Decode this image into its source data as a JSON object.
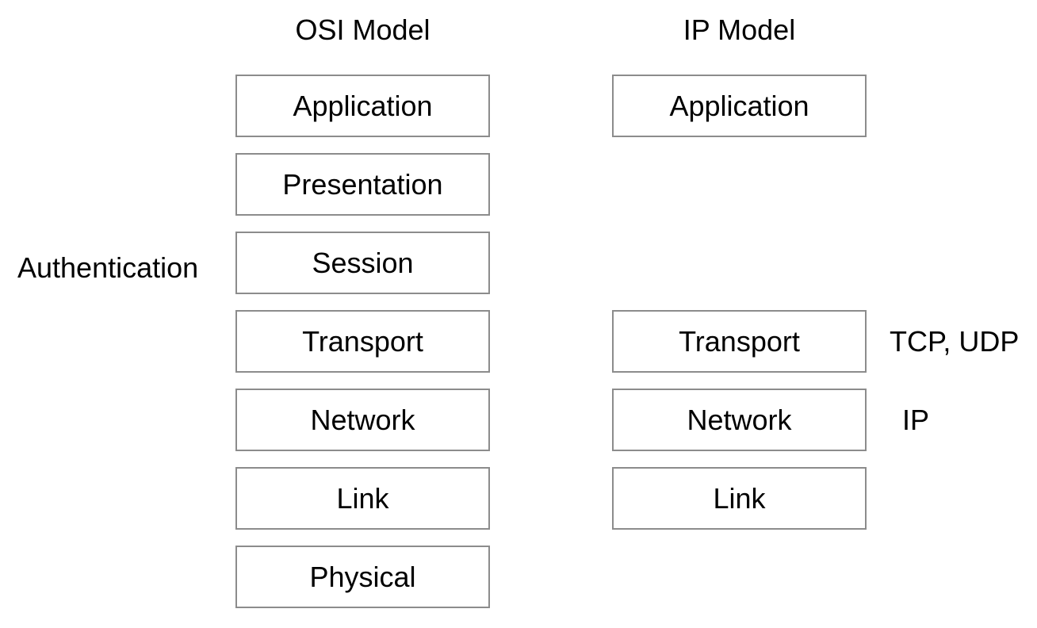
{
  "diagram": {
    "title_osi": "OSI Model",
    "title_ip": "IP Model",
    "left_annotation": "Authentication",
    "osi_layers": [
      "Application",
      "Presentation",
      "Session",
      "Transport",
      "Network",
      "Link",
      "Physical"
    ],
    "ip_layers": [
      "Application",
      "",
      "",
      "Transport",
      "Network",
      "Link",
      ""
    ],
    "right_annotations": {
      "transport": "TCP, UDP",
      "network": "IP"
    },
    "colors": {
      "box_border": "#8c8c8c",
      "box_fill": "#ffffff",
      "text": "#000000",
      "background": "#ffffff"
    }
  }
}
